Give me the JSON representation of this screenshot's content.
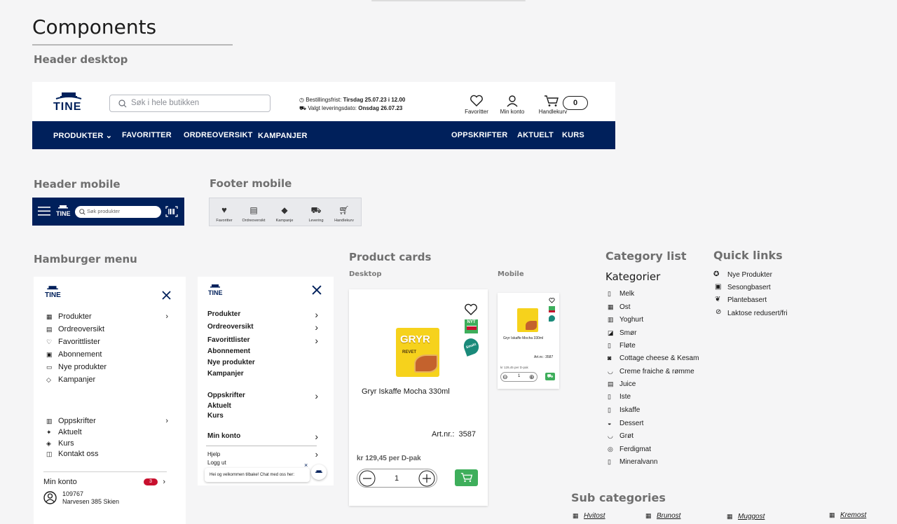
{
  "page": {
    "title": "Components",
    "sections": {
      "header_desktop": "Header desktop",
      "header_mobile": "Header mobile",
      "footer_mobile": "Footer mobile",
      "hamburger_menu": "Hamburger menu",
      "product_cards": "Product cards",
      "product_cards_desktop": "Desktop",
      "product_cards_mobile": "Mobile",
      "category_list": "Category list",
      "quick_links": "Quick links",
      "sub_categories": "Sub categories"
    }
  },
  "brand": {
    "logo_text": "TINE",
    "navy": "#00205b",
    "green": "#3eae5b",
    "badge_red": "#c8102e"
  },
  "header_desktop": {
    "search_placeholder": "Søk i hele butikken",
    "deadline_label": "Bestillingsfrist:",
    "deadline_value": "Tirsdag 25.07.23 i 12.00",
    "delivery_label": "Valgt leveringsdato:",
    "delivery_value": "Onsdag 26.07.23",
    "favorites_label": "Favoritter",
    "account_label": "Min konto",
    "cart_label": "Handlekurv",
    "cart_count": "0",
    "nav_left": [
      "PRODUKTER",
      "FAVORITTER",
      "ORDREOVERSIKT",
      "KAMPANJER"
    ],
    "nav_right": [
      "OPPSKRIFTER",
      "AKTUELT",
      "KURS"
    ]
  },
  "header_mobile": {
    "search_placeholder": "Søk produkter"
  },
  "footer_mobile": {
    "items": [
      "Favoritter",
      "Ordreoversikt",
      "Kampanje",
      "Levering",
      "Handlekurv"
    ]
  },
  "hamburger_a": {
    "main": [
      "Produkter",
      "Ordreoversikt",
      "Favorittlister",
      "Abonnement",
      "Nye produkter",
      "Kampanjer"
    ],
    "secondary": [
      "Oppskrifter",
      "Aktuelt",
      "Kurs",
      "Kontakt oss"
    ],
    "account_label": "Min konto",
    "account_badge": "3",
    "customer_number": "109767",
    "customer_name": "Narvesen 385 Skien"
  },
  "hamburger_b": {
    "group1": [
      "Produkter",
      "Ordreoversikt",
      "Favorittlister",
      "Abonnement",
      "Nye produkter",
      "Kampanjer"
    ],
    "group2": [
      "Oppskrifter",
      "Aktuelt",
      "Kurs"
    ],
    "account_label": "Min konto",
    "help": "Hjelp",
    "logout": "Logg ut",
    "chat_text": "Hei og velkommen tilbake! Chat med oss her:"
  },
  "product_desktop": {
    "name": "Gryr Iskaffe Mocha 330ml",
    "artnr_label": "Art.nr.:",
    "artnr_value": "3587",
    "price": "kr 129,45 per D-pak",
    "quantity": "1",
    "pack_brand": "GRYR",
    "pack_sub": "REVET",
    "badge_new": "NYT",
    "badge_tasted": "Smakt"
  },
  "product_mobile": {
    "name": "Gryr Iskaffe Mocha 330ml",
    "artnr": "Art.nr.: 3587",
    "price": "kr 129,45 per D-pak",
    "quantity": "1"
  },
  "category_list": {
    "heading": "Kategorier",
    "items": [
      "Melk",
      "Ost",
      "Yoghurt",
      "Smør",
      "Fløte",
      "Cottage cheese & Kesam",
      "Creme fraiche & rømme",
      "Juice",
      "Iste",
      "Iskaffe",
      "Dessert",
      "Grøt",
      "Ferdigmat",
      "Mineralvann"
    ]
  },
  "quick_links": {
    "items": [
      "Nye Produkter",
      "Sesongbasert",
      "Plantebasert",
      "Laktose redusert/fri"
    ]
  },
  "sub_categories": {
    "items": [
      "Hvitost",
      "Brunost",
      "Muggost",
      "Kremost"
    ]
  }
}
